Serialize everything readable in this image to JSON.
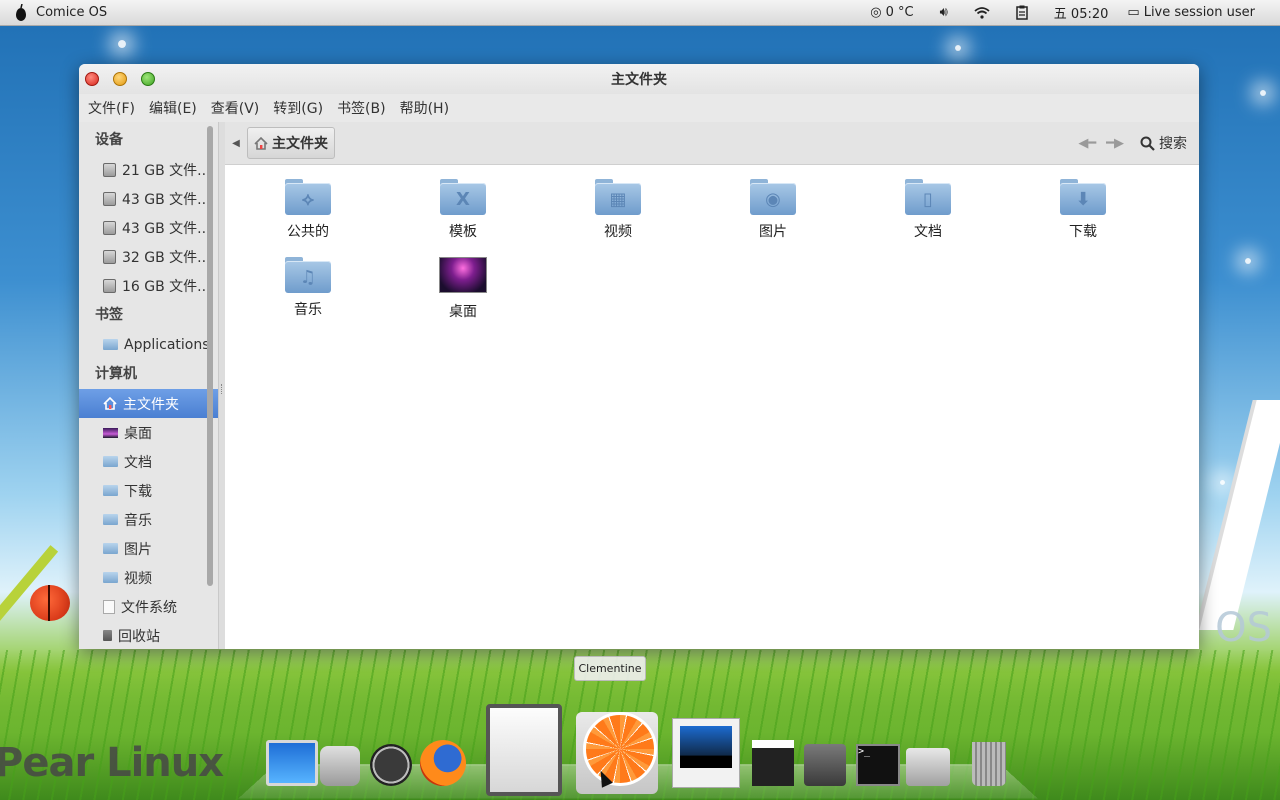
{
  "panel": {
    "app_name": "Comice OS",
    "weather": "0 °C",
    "clock": "五 05:20",
    "user": "Live session user"
  },
  "window": {
    "title": "主文件夹",
    "menu": [
      "文件(F)",
      "编辑(E)",
      "查看(V)",
      "转到(G)",
      "书签(B)",
      "帮助(H)"
    ]
  },
  "sidebar": {
    "devices_header": "设备",
    "devices": [
      "21 GB 文件...",
      "43 GB 文件...",
      "43 GB 文件...",
      "32 GB 文件...",
      "16 GB 文件..."
    ],
    "bookmarks_header": "书签",
    "bookmarks": [
      "Applications"
    ],
    "computer_header": "计算机",
    "computer": [
      "主文件夹",
      "桌面",
      "文档",
      "下载",
      "音乐",
      "图片",
      "视频",
      "文件系统",
      "回收站"
    ]
  },
  "pathbar": {
    "crumb": "主文件夹",
    "search": "搜索"
  },
  "files": [
    {
      "label": "公共的",
      "icon": "public-folder-icon"
    },
    {
      "label": "模板",
      "icon": "templates-folder-icon"
    },
    {
      "label": "视频",
      "icon": "videos-folder-icon"
    },
    {
      "label": "图片",
      "icon": "pictures-folder-icon"
    },
    {
      "label": "文档",
      "icon": "documents-folder-icon"
    },
    {
      "label": "下载",
      "icon": "downloads-folder-icon"
    },
    {
      "label": "音乐",
      "icon": "music-folder-icon"
    },
    {
      "label": "桌面",
      "icon": "desktop-thumbnail-icon"
    }
  ],
  "dock": {
    "tooltip": "Clementine"
  },
  "wallpaper": {
    "brand": "Pear Linux",
    "os_text": "OS"
  },
  "colors": {
    "selection": "#5a8bdb",
    "panel": "#e6e6e6"
  }
}
